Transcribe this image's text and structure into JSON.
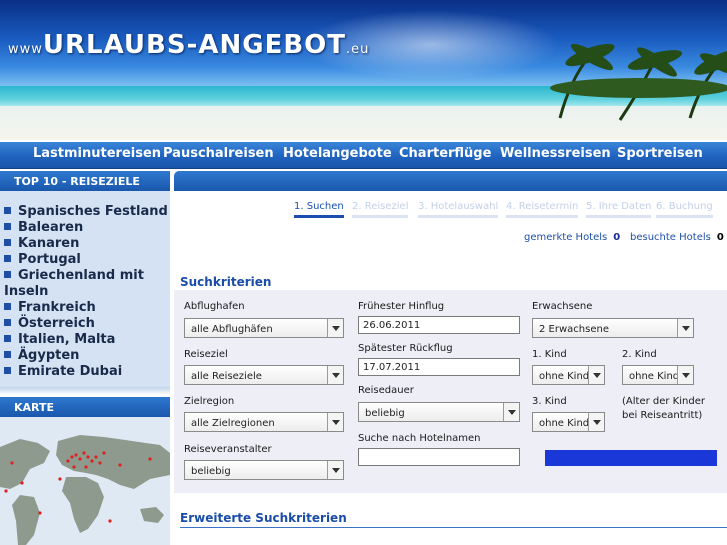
{
  "header": {
    "logo_prefix": "www",
    "logo_main": "URLAUBS-ANGEBOT",
    "logo_suffix": ".eu"
  },
  "nav": {
    "items": [
      "Lastminutereisen",
      "Pauschalreisen",
      "Hotelangebote",
      "Charterflüge",
      "Wellnessreisen",
      "Sportreisen"
    ]
  },
  "sidebar": {
    "top10_title": "TOP 10 - REISEZIELE",
    "top10_items": [
      "Spanisches Festland",
      "Balearen",
      "Kanaren",
      "Portugal",
      "Griechenland mit Inseln",
      "Frankreich",
      "Österreich",
      "Italien, Malta",
      "Ägypten",
      "Emirate Dubai"
    ],
    "map_title": "KARTE"
  },
  "steps": [
    "1. Suchen",
    "2. Reiseziel",
    "3. Hotelauswahl",
    "4. Reisetermin",
    "5. Ihre Daten",
    "6. Buchung"
  ],
  "active_step": 0,
  "links": {
    "marked_label": "gemerkte Hotels",
    "marked_count": "0",
    "visited_label": "besuchte Hotels",
    "visited_count": "0"
  },
  "search": {
    "title": "Suchkriterien",
    "abflughafen_label": "Abflughafen",
    "abflughafen_value": "alle Abflughäfen",
    "reiseziel_label": "Reiseziel",
    "reiseziel_value": "alle Reiseziele",
    "zielregion_label": "Zielregion",
    "zielregion_value": "alle Zielregionen",
    "veranstalter_label": "Reiseveranstalter",
    "veranstalter_value": "beliebig",
    "hinflug_label": "Frühester Hinflug",
    "hinflug_value": "26.06.2011",
    "rueckflug_label": "Spätester Rückflug",
    "rueckflug_value": "17.07.2011",
    "reisedauer_label": "Reisedauer",
    "reisedauer_value": "beliebig",
    "hotelname_label": "Suche nach Hotelnamen",
    "hotelname_value": "",
    "erwachsene_label": "Erwachsene",
    "erwachsene_value": "2 Erwachsene",
    "kind1_label": "1. Kind",
    "kind1_value": "ohne Kind",
    "kind2_label": "2. Kind",
    "kind2_value": "ohne Kind",
    "kind3_label": "3. Kind",
    "kind3_value": "ohne Kind",
    "kinder_hint_1": "(Alter der Kinder",
    "kinder_hint_2": "bei Reiseantritt)"
  },
  "advanced": {
    "title": "Erweiterte Suchkriterien"
  },
  "colors": {
    "nav_blue": "#1f63bf",
    "link_blue": "#1d4fa8",
    "button_blue": "#1a37d8",
    "panel_bg": "#eeeef7",
    "sidebar_bg": "#d5e2f3"
  }
}
